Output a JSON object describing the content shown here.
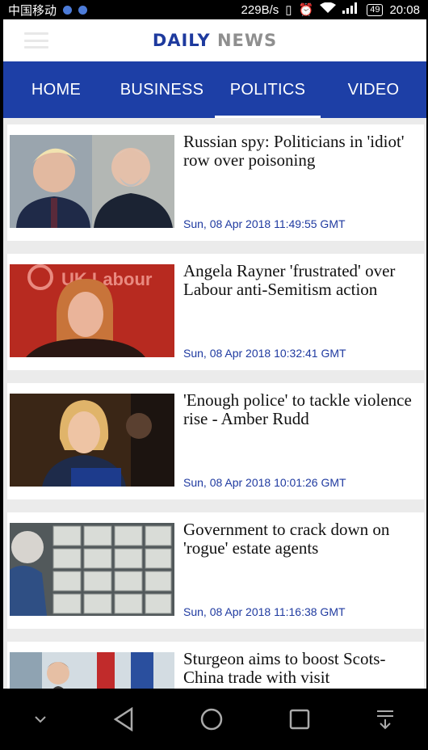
{
  "status_bar": {
    "carrier": "中国移动",
    "speed": "229B/s",
    "battery": "49",
    "time": "20:08"
  },
  "header": {
    "logo_part1": "DAILY",
    "logo_part2": "NEWS"
  },
  "nav": {
    "tabs": [
      {
        "label": "HOME"
      },
      {
        "label": "BUSINESS"
      },
      {
        "label": "POLITICS"
      },
      {
        "label": "VIDEO"
      }
    ],
    "active": "POLITICS"
  },
  "articles": [
    {
      "headline": "Russian spy: Politicians in 'idiot' row over poisoning",
      "date": "Sun, 08 Apr 2018 11:49:55 GMT"
    },
    {
      "headline": "Angela Rayner 'frustrated' over Labour anti-Semitism action",
      "date": "Sun, 08 Apr 2018 10:32:41 GMT"
    },
    {
      "headline": "'Enough police' to tackle violence rise - Amber Rudd",
      "date": "Sun, 08 Apr 2018 10:01:26 GMT"
    },
    {
      "headline": "Government to crack down on 'rogue' estate agents",
      "date": "Sun, 08 Apr 2018 11:16:38 GMT"
    },
    {
      "headline": "Sturgeon aims to boost Scots-China trade with visit",
      "date": ""
    }
  ],
  "thumb_banner_text": "UK Labour",
  "colors": {
    "brand_blue": "#1d3fa6",
    "date_blue": "#1f3aa0"
  }
}
